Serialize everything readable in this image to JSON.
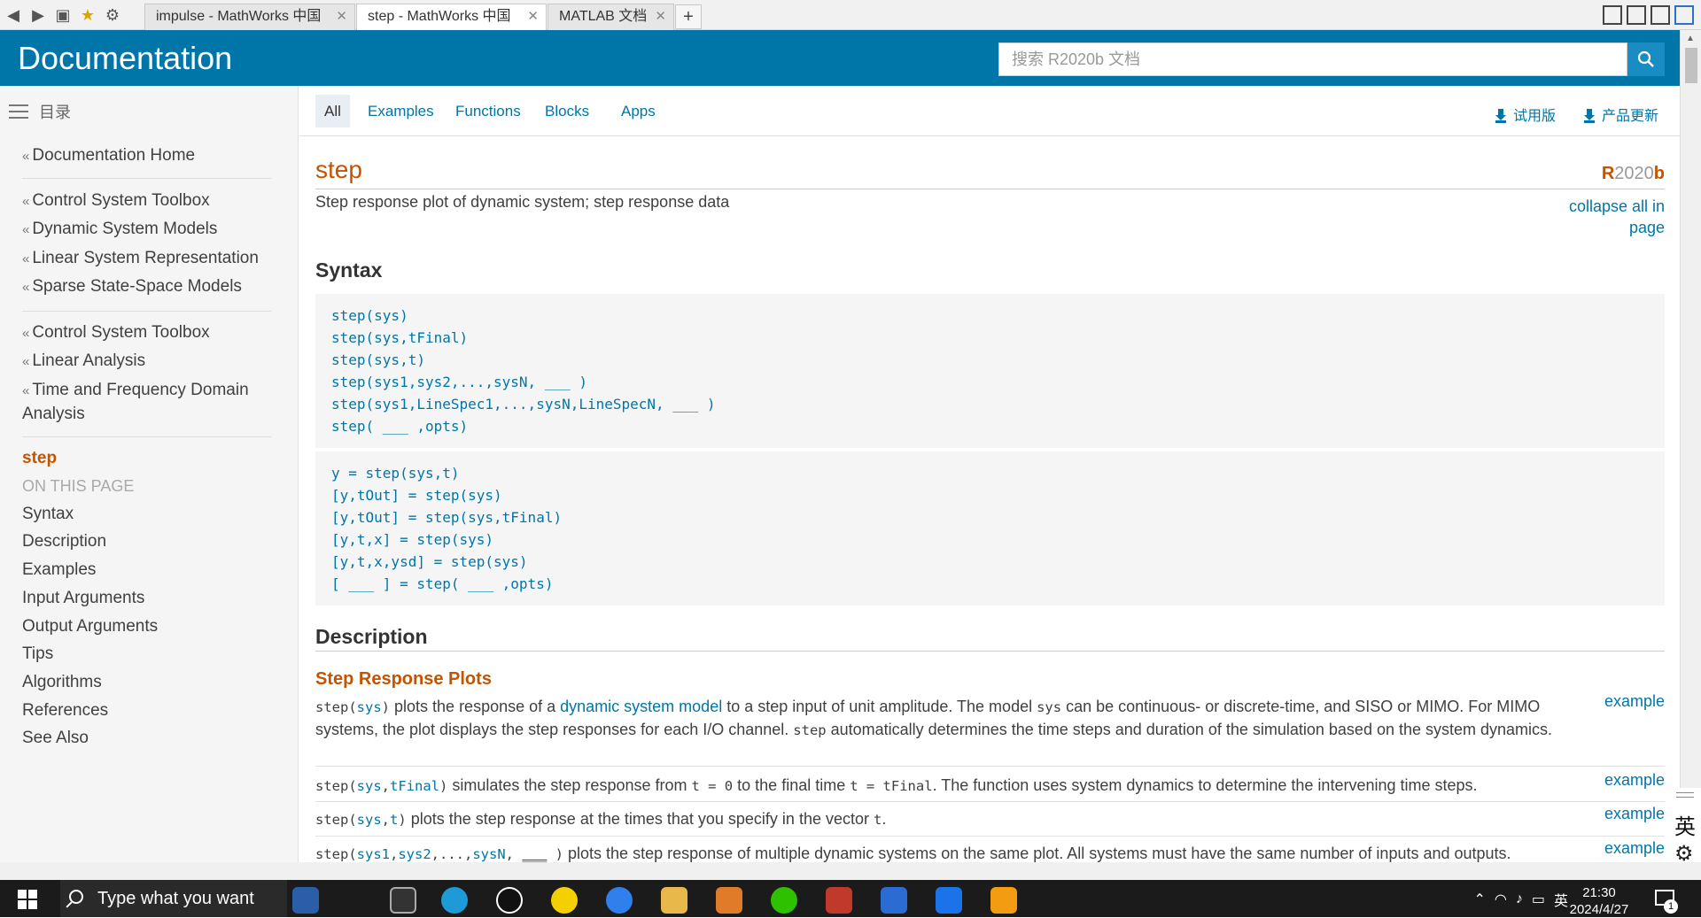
{
  "browser": {
    "tabs": [
      {
        "title": "impulse - MathWorks 中国",
        "close": "✕"
      },
      {
        "title": "step - MathWorks 中国",
        "close": "✕"
      },
      {
        "title": "MATLAB 文档",
        "close": "✕"
      }
    ],
    "new_tab": "+"
  },
  "header": {
    "title": "Documentation",
    "search_placeholder": "搜索 R2020b 文档"
  },
  "sidebar": {
    "toc_label": "目录",
    "group1": [
      {
        "label": "Documentation Home"
      }
    ],
    "group2": [
      {
        "label": "Control System Toolbox"
      },
      {
        "label": "Dynamic System Models"
      },
      {
        "label": "Linear System Representation"
      },
      {
        "label": "Sparse State-Space Models"
      }
    ],
    "group3": [
      {
        "label": "Control System Toolbox"
      },
      {
        "label": "Linear Analysis"
      },
      {
        "label": "Time and Frequency Domain Analysis"
      }
    ],
    "current": "step",
    "on_this_page": "ON THIS PAGE",
    "sections": [
      "Syntax",
      "Description",
      "Examples",
      "Input Arguments",
      "Output Arguments",
      "Tips",
      "Algorithms",
      "References",
      "See Also"
    ]
  },
  "filters": [
    "All",
    "Examples",
    "Functions",
    "Blocks",
    "Apps"
  ],
  "utility_links": {
    "trial": "试用版",
    "updates": "产品更新"
  },
  "page": {
    "title": "step",
    "release_r": "R",
    "release_num": "2020",
    "release_b": "b",
    "purpose": "Step response plot of dynamic system; step response data",
    "collapse": "collapse all in page",
    "syntax_heading": "Syntax",
    "syntax1": [
      "step(sys)",
      "step(sys,tFinal)",
      "step(sys,t)",
      "step(sys1,sys2,...,sysN, ___ )",
      "step(sys1,LineSpec1,...,sysN,LineSpecN, ___ )",
      "step( ___ ,opts)"
    ],
    "syntax2": [
      "y = step(sys,t)",
      "[y,tOut] = step(sys)",
      "[y,tOut] = step(sys,tFinal)",
      "[y,t,x] = step(sys)",
      "[y,t,x,ysd] = step(sys)",
      "[ ___ ] = step( ___ ,opts)"
    ],
    "description_heading": "Description",
    "subheading": "Step Response Plots",
    "example_label": "example",
    "desc1": {
      "code_a": "step(",
      "code_sys": "sys",
      "code_b": ")",
      "t1": " plots the response of a ",
      "link": "dynamic system model",
      "t2": " to a step input of unit amplitude. The model ",
      "code_sys2": "sys",
      "t3": " can be continuous- or discrete-time, and SISO or MIMO. For MIMO systems, the plot displays the step responses for each I/O channel. ",
      "code_step": "step",
      "t4": " automatically determines the time steps and duration of the simulation based on the system dynamics."
    },
    "desc2": {
      "code_a": "step(",
      "code_sys": "sys",
      "code_comma": ",",
      "code_tf": "tFinal",
      "code_b": ")",
      "t1": " simulates the step response from ",
      "code_t0": "t = 0",
      "t2": " to the final time ",
      "code_ttf": "t = tFinal",
      "t3": ". The function uses system dynamics to determine the intervening time steps."
    },
    "desc3": {
      "code_a": "step(",
      "code_sys": "sys",
      "code_comma": ",",
      "code_t": "t",
      "code_b": ")",
      "t1": " plots the step response at the times that you specify in the vector ",
      "code_t2": "t",
      "t2": "."
    },
    "desc4": {
      "code_a": "step(",
      "code_s1": "sys1",
      "code_c1": ",",
      "code_s2": "sys2",
      "code_c2": ",...,",
      "code_sn": "sysN",
      "code_c3": ", ",
      "code_blank": "___",
      "code_b": " )",
      "t1": " plots the step response of multiple dynamic systems on the same plot. All systems must have the same number of inputs and outputs."
    }
  },
  "ime": {
    "lang": "英"
  },
  "taskbar": {
    "search_text": "Type what you want",
    "tray_lang": "英",
    "time": "21:30",
    "date": "2024/4/27",
    "notif_count": "1"
  }
}
